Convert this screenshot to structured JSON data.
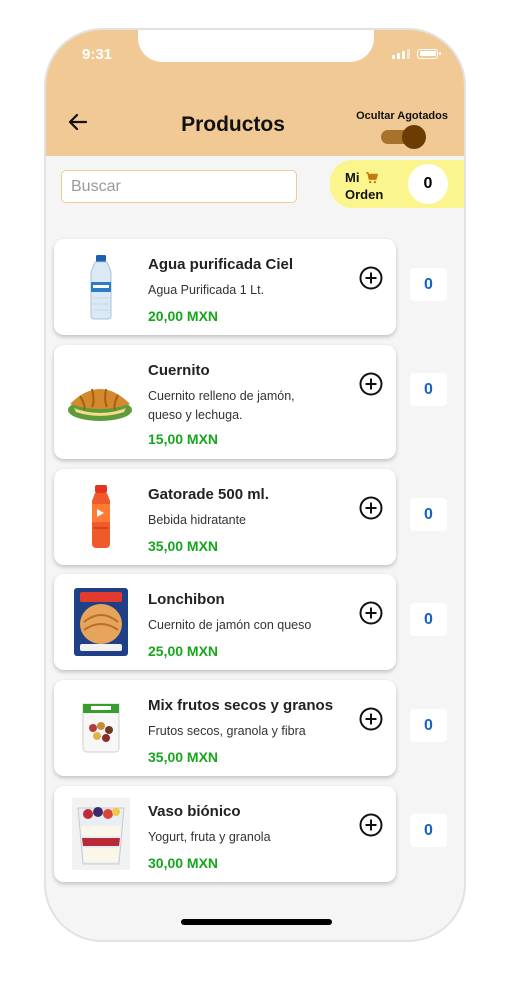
{
  "status_bar": {
    "time": "9:31"
  },
  "header": {
    "title": "Productos",
    "toggle_label": "Ocultar Agotados",
    "toggle_on": true
  },
  "search": {
    "placeholder": "Buscar",
    "value": ""
  },
  "order": {
    "line1": "Mi",
    "line2": "Orden",
    "count": "0",
    "icon": "cart-icon"
  },
  "colors": {
    "header": "#f0c994",
    "order_bg": "#fbf58e",
    "price": "#17a51d",
    "qty": "#1565c0",
    "toggle_thumb": "#6b3d05"
  },
  "products": [
    {
      "name": "Agua purificada Ciel",
      "description": "Agua Purificada 1 Lt.",
      "price": "20,00 MXN",
      "qty": "0",
      "image": "water-bottle-image"
    },
    {
      "name": "Cuernito",
      "description": "Cuernito relleno de jamón, queso y lechuga.",
      "price": "15,00 MXN",
      "qty": "0",
      "image": "croissant-image"
    },
    {
      "name": "Gatorade 500 ml.",
      "description": "Bebida hidratante",
      "price": "35,00 MXN",
      "qty": "0",
      "image": "sports-drink-image"
    },
    {
      "name": "Lonchibon",
      "description": "Cuernito de jamón con queso",
      "price": "25,00 MXN",
      "qty": "0",
      "image": "packaged-snack-image"
    },
    {
      "name": "Mix frutos secos y granos",
      "description": "Frutos secos, granola y fibra",
      "price": "35,00 MXN",
      "qty": "0",
      "image": "nut-mix-bag-image"
    },
    {
      "name": "Vaso biónico",
      "description": "Yogurt, fruta y granola",
      "price": "30,00 MXN",
      "qty": "0",
      "image": "fruit-cup-image"
    }
  ]
}
